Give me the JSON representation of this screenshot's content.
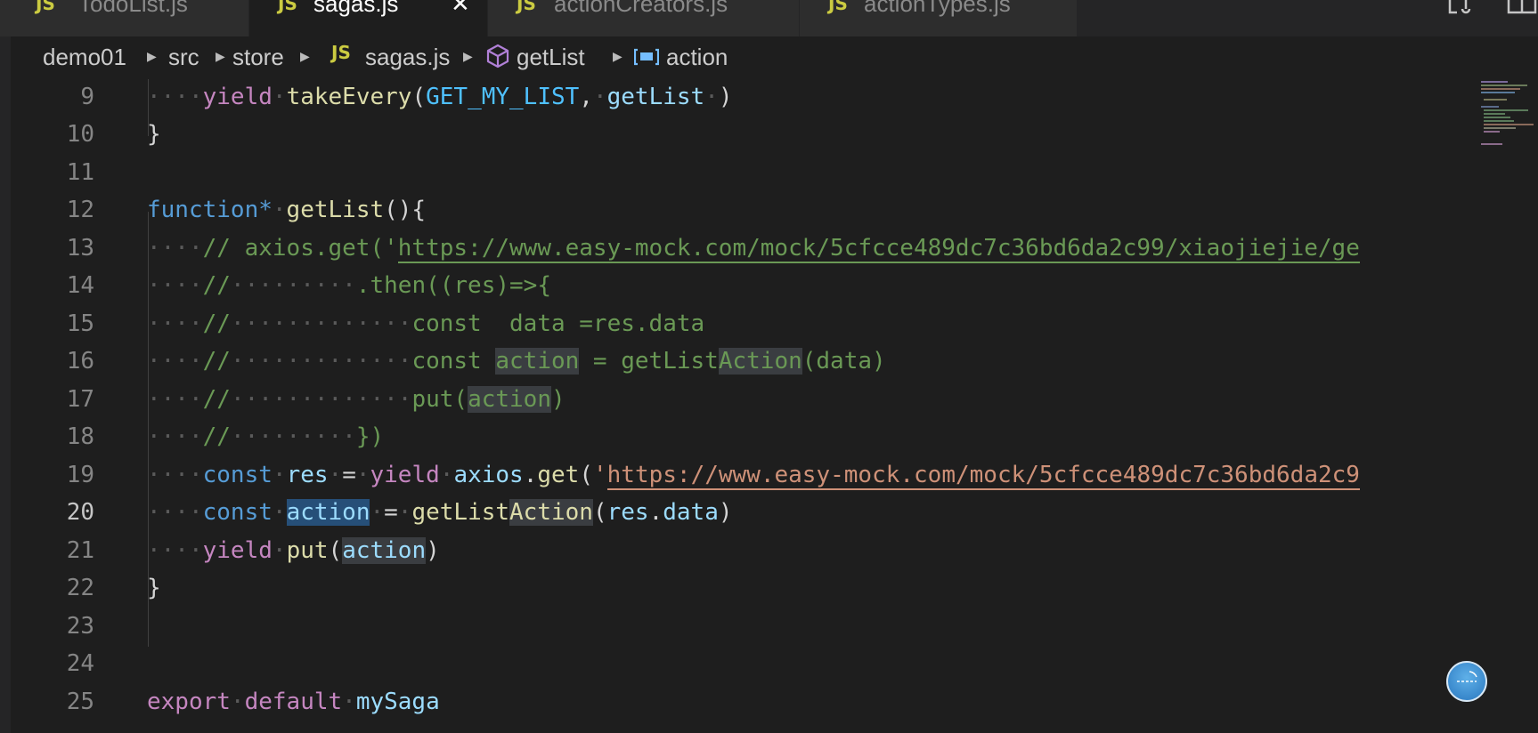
{
  "tabs": [
    {
      "badge": "JS",
      "label": "TodoList.js",
      "active": false
    },
    {
      "badge": "JS",
      "label": "sagas.js",
      "active": true,
      "close": "✕"
    },
    {
      "badge": "JS",
      "label": "actionCreators.js",
      "active": false
    },
    {
      "badge": "JS",
      "label": "actionTypes.js",
      "active": false
    }
  ],
  "breadcrumb": {
    "items": [
      "demo01",
      "src",
      "store",
      "sagas.js",
      "getList",
      "action"
    ],
    "separator": "▶",
    "file_badge": "JS"
  },
  "icons": {
    "compare": "compare-icon",
    "split": "split-editor-icon",
    "symbol_method": "cube-icon",
    "symbol_variable": "variable-icon"
  },
  "editor": {
    "current_line": "20",
    "lines": [
      {
        "num": "9"
      },
      {
        "num": "10"
      },
      {
        "num": "11"
      },
      {
        "num": "12"
      },
      {
        "num": "13"
      },
      {
        "num": "14"
      },
      {
        "num": "15"
      },
      {
        "num": "16"
      },
      {
        "num": "17"
      },
      {
        "num": "18"
      },
      {
        "num": "19"
      },
      {
        "num": "20"
      },
      {
        "num": "21"
      },
      {
        "num": "22"
      },
      {
        "num": "23"
      },
      {
        "num": "24"
      },
      {
        "num": "25"
      }
    ],
    "tokens": {
      "yield": "yield",
      "takeEvery": "takeEvery",
      "GET_MY_LIST": "GET_MY_LIST",
      "getList": "getList",
      "function": "function*",
      "export": "export",
      "default": "default",
      "mySaga": "mySaga",
      "comment13": "// axios.get('",
      "url13": "https://www.easy-mock.com/mock/5cfcce489dc7c36bd6da2c99/xiaojiejie/ge",
      "comment14": ".then((res)=>{",
      "comment15": "const  data =res.data",
      "comment16a": "const ",
      "comment16b": "action",
      "comment16c": " = getList",
      "comment16d": "Action",
      "comment16e": "(data)",
      "comment17a": "put(",
      "comment17b": "action",
      "comment17c": ")",
      "comment18": "})",
      "const": "const",
      "res": "res",
      "axios": "axios",
      "get": "get",
      "url19": "https://www.easy-mock.com/mock/5cfcce489dc7c36bd6da2c9",
      "action": "action",
      "getListA": "getList",
      "Action": "Action",
      "resdata_res": "res",
      "resdata_data": "data",
      "put": "put"
    }
  },
  "colors": {
    "background": "#1e1e1e",
    "keyword": "#569cd6",
    "control": "#c586c0",
    "function": "#dcdcaa",
    "variable": "#9cdcfe",
    "constant": "#4fc1ff",
    "comment": "#6a9955",
    "string": "#ce9178"
  }
}
